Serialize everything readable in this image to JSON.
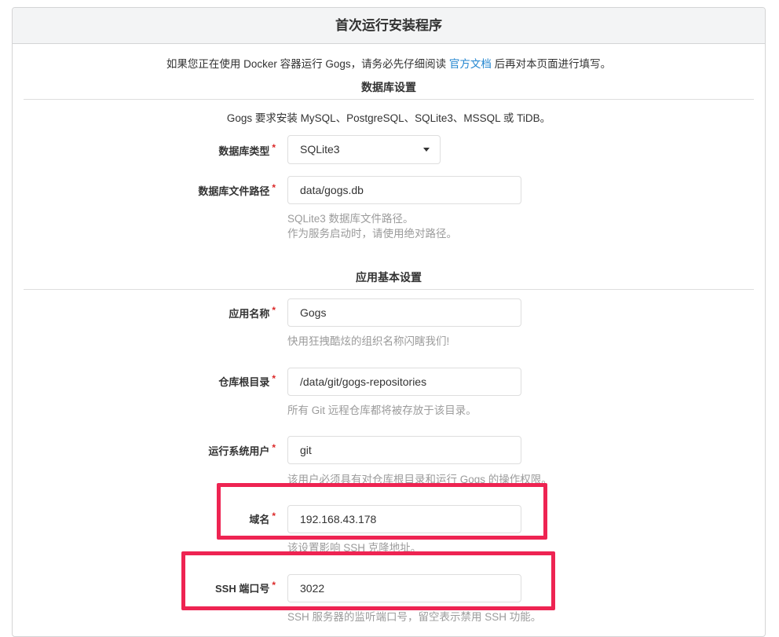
{
  "header": {
    "title": "首次运行安装程序"
  },
  "intro": {
    "before": "如果您正在使用 Docker 容器运行 Gogs，请务必先仔细阅读 ",
    "link": "官方文档",
    "after": " 后再对本页面进行填写。"
  },
  "database": {
    "section_title": "数据库设置",
    "requirement": "Gogs 要求安装 MySQL、PostgreSQL、SQLite3、MSSQL 或 TiDB。",
    "type_label": "数据库类型",
    "type_value": "SQLite3",
    "path_label": "数据库文件路径",
    "path_value": "data/gogs.db",
    "path_help_1": "SQLite3 数据库文件路径。",
    "path_help_2": "作为服务启动时，请使用绝对路径。"
  },
  "app": {
    "section_title": "应用基本设置",
    "name_label": "应用名称",
    "name_value": "Gogs",
    "name_help": "快用狂拽酷炫的组织名称闪瞎我们!",
    "repo_label": "仓库根目录",
    "repo_value": "/data/git/gogs-repositories",
    "repo_help": "所有 Git 远程仓库都将被存放于该目录。",
    "user_label": "运行系统用户",
    "user_value": "git",
    "user_help": "该用户必须具有对仓库根目录和运行 Gogs 的操作权限。",
    "domain_label": "域名",
    "domain_value": "192.168.43.178",
    "domain_help": "该设置影响 SSH 克隆地址。",
    "ssh_label": "SSH 端口号",
    "ssh_value": "3022",
    "ssh_help": "SSH 服务器的监听端口号，留空表示禁用 SSH 功能。"
  },
  "required_mark": "*",
  "colors": {
    "link": "#2185d0",
    "required": "#db2828",
    "highlight": "#ee2452",
    "help_text": "#9b9b9b"
  }
}
